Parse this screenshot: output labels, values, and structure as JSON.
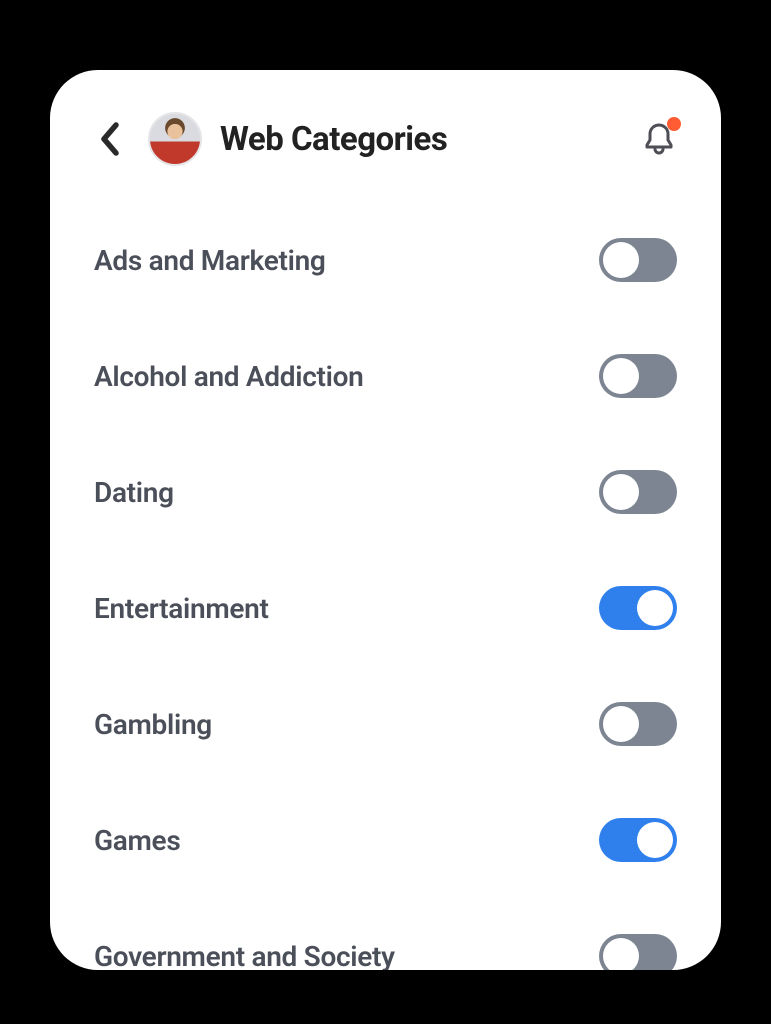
{
  "header": {
    "title": "Web Categories",
    "avatar_alt": "child-profile",
    "has_notification": true
  },
  "categories": [
    {
      "label": "Ads and Marketing",
      "enabled": false
    },
    {
      "label": "Alcohol and Addiction",
      "enabled": false
    },
    {
      "label": "Dating",
      "enabled": false
    },
    {
      "label": "Entertainment",
      "enabled": true
    },
    {
      "label": "Gambling",
      "enabled": false
    },
    {
      "label": "Games",
      "enabled": true
    },
    {
      "label": "Government and Society",
      "enabled": false
    }
  ],
  "colors": {
    "toggle_on": "#2f80ed",
    "toggle_off": "#7d8592",
    "notif_dot": "#ff5c33"
  }
}
